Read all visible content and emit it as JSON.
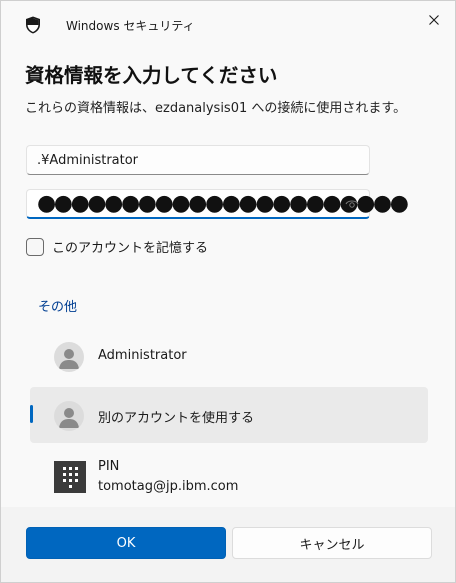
{
  "window": {
    "title": "Windows セキュリティ",
    "app_icon": "shield-icon",
    "close_icon": "close-icon"
  },
  "dialog": {
    "heading": "資格情報を入力してください",
    "description": "これらの資格情報は、ezdanalysis01 への接続に使用されます。"
  },
  "form": {
    "username_value": ".¥Administrator",
    "password_dots": "●●●●●●●●●●●●●●●●●●●●●●",
    "reveal_icon": "eye-icon",
    "remember_label": "このアカウントを記憶する",
    "remember_checked": false
  },
  "other": {
    "label": "その他",
    "accounts": [
      {
        "label": "Administrator",
        "icon": "user-avatar-icon"
      },
      {
        "label": "別のアカウントを使用する",
        "icon": "user-avatar-icon",
        "selected": true
      },
      {
        "label": "PIN",
        "sublabel": "tomotag@jp.ibm.com",
        "icon": "pin-keypad-icon"
      }
    ]
  },
  "buttons": {
    "ok": "OK",
    "cancel": "キャンセル"
  },
  "colors": {
    "accent": "#0067c0",
    "link": "#003e92",
    "background": "#f9f9f9",
    "footer": "#f3f3f3"
  }
}
